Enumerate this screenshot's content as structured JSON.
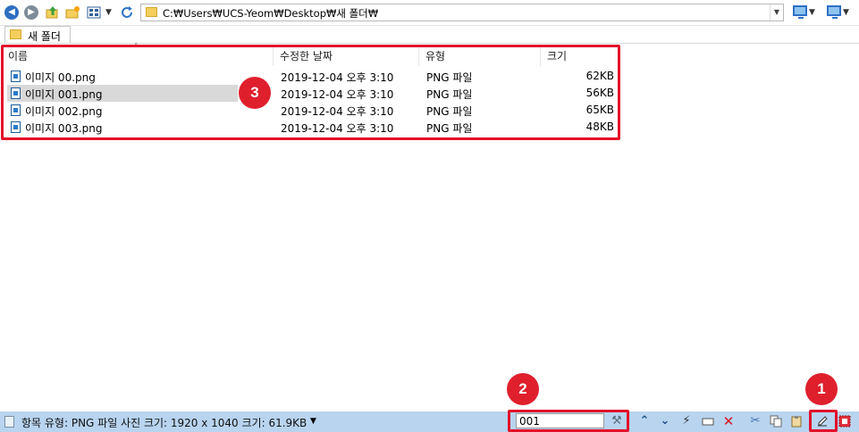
{
  "toolbar": {
    "address_path": "C:₩Users₩UCS-Yeom₩Desktop₩새 폴더₩",
    "icons": [
      "back-icon",
      "forward-icon",
      "up-folder-icon",
      "new-folder-icon",
      "view-mode-icon",
      "refresh-icon"
    ]
  },
  "tab": {
    "label": "새 폴더"
  },
  "columns": {
    "name": "이름",
    "date": "수정한 날짜",
    "type": "유형",
    "size": "크기"
  },
  "files": [
    {
      "name": "이미지 00.png",
      "date": "2019-12-04 오후 3:10",
      "type": "PNG 파일",
      "size": "62KB"
    },
    {
      "name": "이미지 001.png",
      "date": "2019-12-04 오후 3:10",
      "type": "PNG 파일",
      "size": "56KB"
    },
    {
      "name": "이미지 002.png",
      "date": "2019-12-04 오후 3:10",
      "type": "PNG 파일",
      "size": "65KB"
    },
    {
      "name": "이미지 003.png",
      "date": "2019-12-04 오후 3:10",
      "type": "PNG 파일",
      "size": "48KB"
    }
  ],
  "status": {
    "info_text": "항목 유형: PNG 파일 사진 크기: 1920 x 1040 크기: 61.9KB",
    "filter_value": "001"
  },
  "annotations": {
    "badge1": "1",
    "badge2": "2",
    "badge3": "3"
  },
  "colors": {
    "annotation_red": "#e2102a",
    "status_bar": "#b8d4ef",
    "selection": "#d9d9d9"
  }
}
